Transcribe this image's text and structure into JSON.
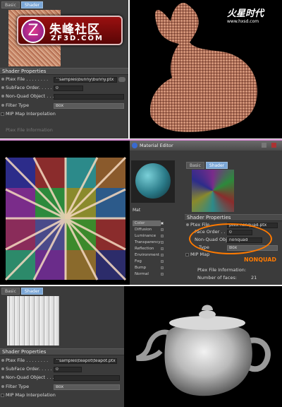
{
  "top": {
    "tabs": [
      "Basic",
      "Shader"
    ],
    "section": "Shader Properties",
    "rows": [
      {
        "label": "Ptex File . . . . . . . .",
        "value": "^samples\\bunny\\bunny.ptx"
      },
      {
        "label": "SubFace Order. . . . . .",
        "value": "0"
      },
      {
        "label": "Non-Quad Object . . . .",
        "value": ""
      },
      {
        "label": "Filter Type",
        "value": "Box"
      },
      {
        "label": "MIP Map Interpolation",
        "value": ""
      }
    ],
    "footer_hint": "Ptex File Information"
  },
  "logo": {
    "cn": "朱峰社区",
    "en": "ZF3D.COM",
    "watermark": "火星时代",
    "url": "www.hxsd.com"
  },
  "middle": {
    "window_title": "Material Editor",
    "tabs": [
      "Basic",
      "Shader"
    ],
    "material_name": "Mat",
    "channels": [
      "Color",
      "Diffusion",
      "Luminance",
      "Transparency",
      "Reflection",
      "Environment",
      "Fog",
      "Bump",
      "Normal"
    ],
    "section": "Shader Properties",
    "rows": [
      {
        "label": "Ptex File",
        "value": "ptex nonquad.ptx"
      },
      {
        "label": "Face Order . .",
        "value": "0"
      },
      {
        "label": "Non-Quad Object",
        "value": "nonquad"
      },
      {
        "label": "Type",
        "value": "Box"
      },
      {
        "label": "MIP Map",
        "value": ""
      }
    ],
    "annotation": "NONQUAD",
    "info_title": "Ptex File Information:",
    "info_label": "Number of faces:",
    "info_value": "21"
  },
  "bottom": {
    "tabs": [
      "Basic",
      "Shader"
    ],
    "section": "Shader Properties",
    "rows": [
      {
        "label": "Ptex File . . . . . . . .",
        "value": "^samples\\teapot\\teapot.ptx"
      },
      {
        "label": "SubFace Order. . . . . .",
        "value": "0"
      },
      {
        "label": "Non-Quad Object . . . .",
        "value": ""
      },
      {
        "label": "Filter Type",
        "value": "Box"
      },
      {
        "label": "MIP Map Interpolation",
        "value": ""
      }
    ]
  },
  "colors": {
    "accent_tab": "#7aa6d6",
    "annotation": "#ff7a00",
    "separator_top": "#d48ad0"
  }
}
